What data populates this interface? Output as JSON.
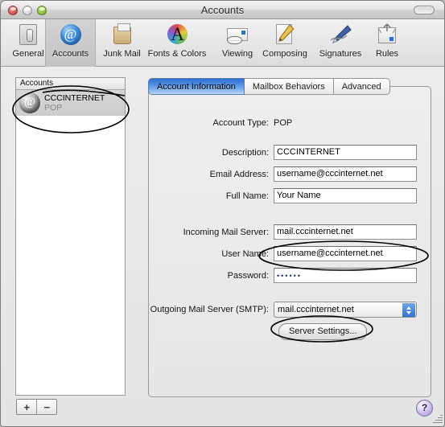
{
  "window": {
    "title": "Accounts",
    "traffic_lights": [
      "close-button",
      "minimize-button",
      "zoom-button"
    ],
    "toolbar_toggle": "toolbar-toggle-button"
  },
  "toolbar": {
    "items": [
      {
        "label": "General",
        "icon": "general-icon",
        "selected": false
      },
      {
        "label": "Accounts",
        "icon": "accounts-at-icon",
        "selected": true
      },
      {
        "label": "Junk Mail",
        "icon": "junk-mail-bag-icon",
        "selected": false
      },
      {
        "label": "Fonts & Colors",
        "icon": "fonts-colors-icon",
        "selected": false
      },
      {
        "label": "Viewing",
        "icon": "viewing-glasses-icon",
        "selected": false
      },
      {
        "label": "Composing",
        "icon": "composing-pencil-icon",
        "selected": false
      },
      {
        "label": "Signatures",
        "icon": "signatures-pen-icon",
        "selected": false
      },
      {
        "label": "Rules",
        "icon": "rules-icon",
        "selected": false
      }
    ]
  },
  "sidebar": {
    "header": "Accounts",
    "accounts": [
      {
        "name": "CCCINTERNET",
        "type": "POP",
        "icon": "globe-at-icon",
        "selected": true
      }
    ],
    "add_button": "+",
    "remove_button": "−"
  },
  "tabs": [
    {
      "label": "Account Information",
      "active": true
    },
    {
      "label": "Mailbox Behaviors",
      "active": false
    },
    {
      "label": "Advanced",
      "active": false
    }
  ],
  "form": {
    "account_type": {
      "label": "Account Type:",
      "value": "POP"
    },
    "description": {
      "label": "Description:",
      "value": "CCCINTERNET"
    },
    "email": {
      "label": "Email Address:",
      "value": "username@cccinternet.net"
    },
    "full_name": {
      "label": "Full Name:",
      "value": "Your Name"
    },
    "incoming": {
      "label": "Incoming Mail Server:",
      "value": "mail.cccinternet.net"
    },
    "user_name": {
      "label": "User Name:",
      "value": "username@cccinternet.net"
    },
    "password": {
      "label": "Password:",
      "value": "••••••"
    },
    "smtp": {
      "label": "Outgoing Mail Server (SMTP):",
      "value": "mail.cccinternet.net"
    },
    "server_settings_button": "Server Settings..."
  },
  "help_button": "?",
  "annotations": {
    "colors": {
      "stroke": "#000000"
    },
    "ellipses": [
      {
        "name": "annotation-ellipse-account-row"
      },
      {
        "name": "annotation-ellipse-user-name"
      },
      {
        "name": "annotation-ellipse-server-settings"
      }
    ]
  }
}
